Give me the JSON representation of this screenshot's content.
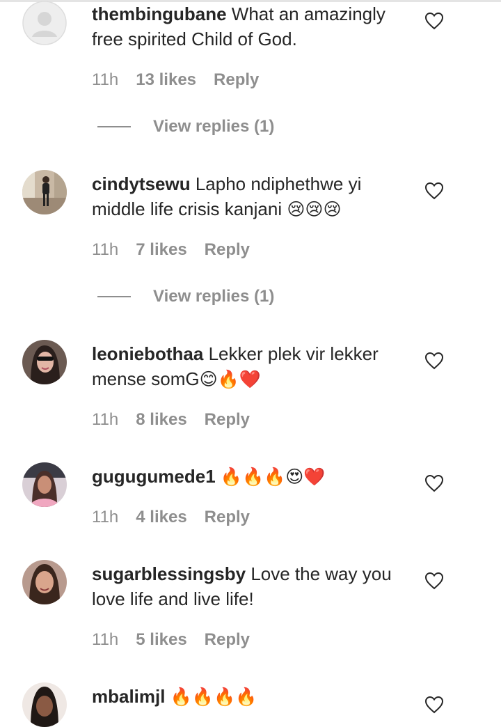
{
  "comments": [
    {
      "username": "thembingubane",
      "text": "What an amazingly free spirited Child of God.",
      "emoji": "",
      "time": "11h",
      "likes": "13 likes",
      "reply": "Reply",
      "view_replies": "View replies (1)",
      "avatar": "default-avatar-icon"
    },
    {
      "username": "cindytsewu",
      "text": "Lapho ndiphethwe yi middle life crisis kanjani",
      "emoji": "😢😢😢",
      "time": "11h",
      "likes": "7 likes",
      "reply": "Reply",
      "view_replies": "View replies (1)",
      "avatar": "user-photo"
    },
    {
      "username": "leoniebothaa",
      "text": "Lekker plek vir lekker mense somG",
      "emoji": "😊🔥❤️",
      "time": "11h",
      "likes": "8 likes",
      "reply": "Reply",
      "avatar": "user-photo"
    },
    {
      "username": "gugugumede1",
      "text": "",
      "emoji": "🔥🔥🔥😍❤️",
      "time": "11h",
      "likes": "4 likes",
      "reply": "Reply",
      "avatar": "user-photo"
    },
    {
      "username": "sugarblessingsby",
      "text": "Love the way you love life and live life!",
      "emoji": "",
      "time": "11h",
      "likes": "5 likes",
      "reply": "Reply",
      "avatar": "user-photo"
    },
    {
      "username": "mbalimjl",
      "text": "",
      "emoji": "🔥🔥🔥🔥",
      "avatar": "user-photo"
    }
  ],
  "icons": {
    "like": "heart-outline-icon"
  },
  "colors": {
    "text": "#262626",
    "secondary": "#8e8e8e",
    "background": "#ffffff"
  }
}
